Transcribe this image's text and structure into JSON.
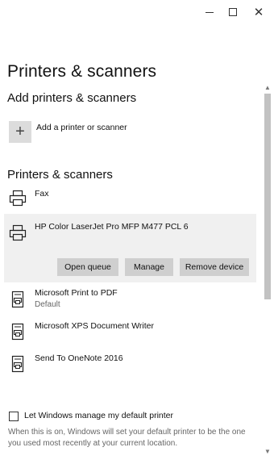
{
  "window": {
    "minimize_glyph": "–",
    "close_glyph": "✕"
  },
  "page": {
    "title": "Printers & scanners"
  },
  "add_section": {
    "heading": "Add printers & scanners",
    "add_icon": "+",
    "add_label": "Add a printer or scanner"
  },
  "list_section": {
    "heading": "Printers & scanners",
    "printers": [
      {
        "name": "Fax",
        "sub": "",
        "icon": "printer-icon"
      },
      {
        "name": "HP Color LaserJet Pro MFP M477 PCL 6",
        "sub": "",
        "icon": "printer-icon",
        "selected": true
      },
      {
        "name": "Microsoft Print to PDF",
        "sub": "Default",
        "icon": "document-printer-icon"
      },
      {
        "name": "Microsoft XPS Document Writer",
        "sub": "",
        "icon": "document-printer-icon"
      },
      {
        "name": "Send To OneNote 2016",
        "sub": "",
        "icon": "document-printer-icon"
      }
    ],
    "actions": {
      "open_queue": "Open queue",
      "manage": "Manage",
      "remove_device": "Remove device"
    }
  },
  "default_setting": {
    "checked": false,
    "label": "Let Windows manage my default printer",
    "description": "When this is on, Windows will set your default printer to be the one you used most recently at your current location."
  },
  "colors": {
    "selected_bg": "#f0f0f0",
    "button_bg": "#cfcfcf",
    "scroll_thumb": "#c2c2c2"
  }
}
